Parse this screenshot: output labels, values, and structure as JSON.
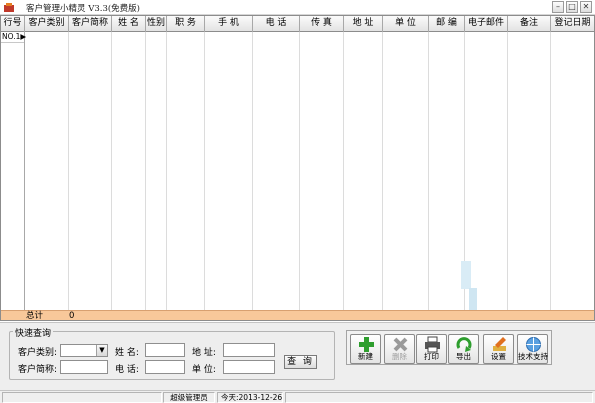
{
  "window": {
    "title": "客户管理小精灵 V3.3(免费版)"
  },
  "grid": {
    "columns": [
      {
        "label": "行号"
      },
      {
        "label": "客户类别"
      },
      {
        "label": "客户简称"
      },
      {
        "label": "姓 名"
      },
      {
        "label": "性别"
      },
      {
        "label": "职 务"
      },
      {
        "label": "手 机"
      },
      {
        "label": "电 话"
      },
      {
        "label": "传 真"
      },
      {
        "label": "地 址"
      },
      {
        "label": "单 位"
      },
      {
        "label": "邮 编"
      },
      {
        "label": "电子邮件"
      },
      {
        "label": "备注"
      },
      {
        "label": "登记日期"
      }
    ],
    "current_row_label": "NO.1▶",
    "summary": {
      "label": "总计",
      "value": "0"
    }
  },
  "query": {
    "legend": "快速查询",
    "category_label": "客户类别:",
    "category_value": "",
    "name_label": "姓 名:",
    "name_value": "",
    "address_label": "地 址:",
    "address_value": "",
    "short_name_label": "客户简称:",
    "short_name_value": "",
    "phone_label": "电 话:",
    "phone_value": "",
    "unit_label": "单 位:",
    "unit_value": "",
    "button_label": "查 询"
  },
  "toolbar": {
    "new_label": "新建",
    "delete_label": "删除",
    "print_label": "打印",
    "export_label": "导出",
    "settings_label": "设置",
    "support_label": "技术支持"
  },
  "status": {
    "user": "超级管理员",
    "today": "今天:2013-12-26"
  },
  "colors": {
    "summary_bg": "#f8c89a",
    "new_icon": "#2e9e2e",
    "delete_icon": "#9a9a9a"
  }
}
